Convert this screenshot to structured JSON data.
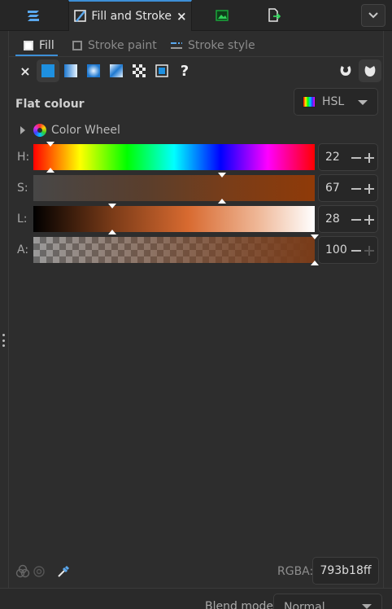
{
  "dock": {
    "tabs": [
      {
        "name": "layers-tab",
        "icon": "layers-icon"
      },
      {
        "name": "fill-stroke-tab",
        "label": "Fill and Stroke",
        "icon": "fill-stroke-icon",
        "active": true
      },
      {
        "name": "image-tab",
        "icon": "image-icon"
      },
      {
        "name": "export-tab",
        "icon": "export-document-icon"
      }
    ],
    "close_glyph": "×",
    "menu_icon": "chevron-down-icon"
  },
  "subtabs": [
    {
      "label": "Fill",
      "active": true
    },
    {
      "label": "Stroke paint",
      "active": false
    },
    {
      "label": "Stroke style",
      "active": false
    }
  ],
  "paint_types": [
    "no-paint",
    "flat-color",
    "linear-gradient",
    "radial-gradient",
    "mesh-gradient",
    "pattern",
    "swatch",
    "unset"
  ],
  "paint_glyphs": {
    "none": "×",
    "unset": "?"
  },
  "flat_colour": {
    "title": "Flat colour",
    "mode": "HSL",
    "color_wheel_label": "Color Wheel"
  },
  "sliders": [
    {
      "label": "H:",
      "value": "22",
      "fraction": 0.06
    },
    {
      "label": "S:",
      "value": "67",
      "fraction": 0.67
    },
    {
      "label": "L:",
      "value": "28",
      "fraction": 0.28
    },
    {
      "label": "A:",
      "value": "100",
      "fraction": 1.0
    }
  ],
  "rgba": {
    "label": "RGBA:",
    "value": "793b18ff"
  },
  "blend": {
    "label": "Blend mode:",
    "value": "Normal"
  },
  "colors": {
    "accent": "#3d8fd7",
    "current": "#793b18"
  }
}
